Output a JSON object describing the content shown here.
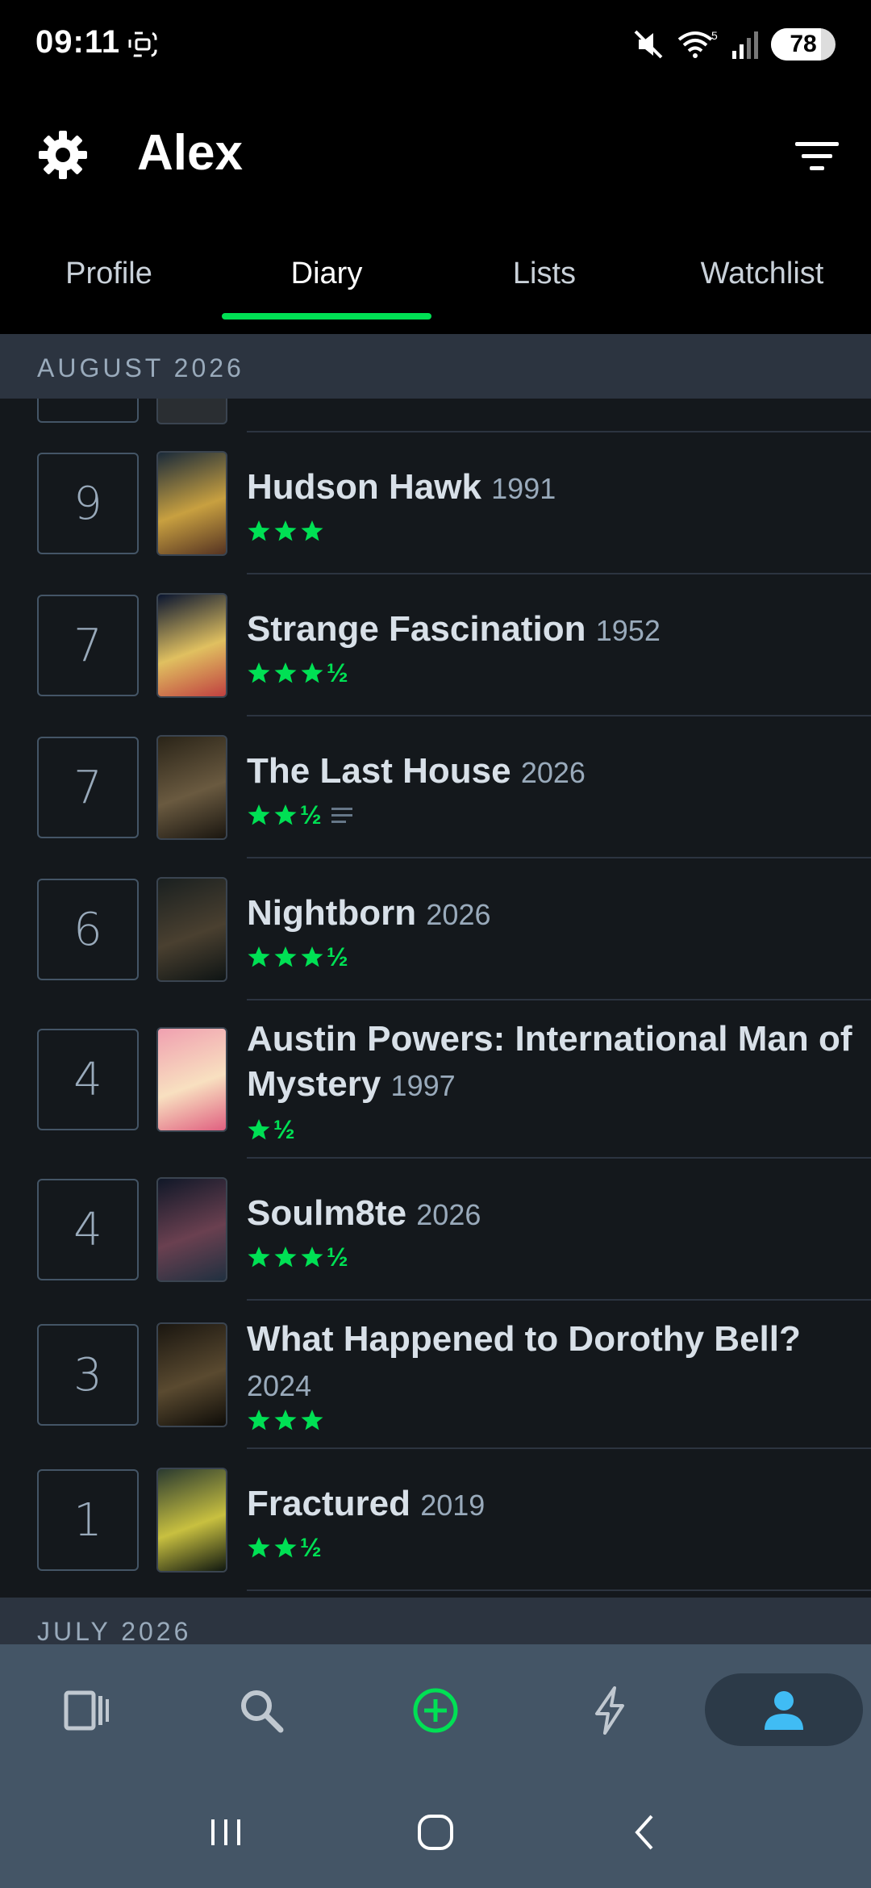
{
  "status_bar": {
    "time": "09:11",
    "battery": "78"
  },
  "header": {
    "title": "Alex"
  },
  "tabs": [
    {
      "label": "Profile",
      "active": false
    },
    {
      "label": "Diary",
      "active": true
    },
    {
      "label": "Lists",
      "active": false
    },
    {
      "label": "Watchlist",
      "active": false
    }
  ],
  "sections": [
    {
      "label": "AUGUST 2026"
    },
    {
      "label": "JULY 2026"
    }
  ],
  "entries": [
    {
      "day": "9",
      "title": "Hudson Hawk",
      "year": "1991",
      "stars": 3,
      "half": false,
      "review": false,
      "poster_colors": [
        "#1a2a3a",
        "#c8a040",
        "#553322"
      ]
    },
    {
      "day": "7",
      "title": "Strange Fascination",
      "year": "1952",
      "stars": 3,
      "half": true,
      "review": false,
      "poster_colors": [
        "#0a1530",
        "#e0c060",
        "#c04040"
      ]
    },
    {
      "day": "7",
      "title": "The Last House",
      "year": "2026",
      "stars": 2,
      "half": true,
      "review": true,
      "poster_colors": [
        "#2a2418",
        "#6a5a40",
        "#1a1610"
      ]
    },
    {
      "day": "6",
      "title": "Nightborn",
      "year": "2026",
      "stars": 3,
      "half": true,
      "review": false,
      "poster_colors": [
        "#1a2020",
        "#4a4030",
        "#0e1414"
      ]
    },
    {
      "day": "4",
      "title": "Austin Powers: International Man of Mystery",
      "year": "1997",
      "stars": 1,
      "half": true,
      "review": false,
      "poster_colors": [
        "#f0a0b0",
        "#f8e0c0",
        "#e06080"
      ]
    },
    {
      "day": "4",
      "title": "Soulm8te",
      "year": "2026",
      "stars": 3,
      "half": true,
      "review": false,
      "poster_colors": [
        "#101828",
        "#6a4050",
        "#203040"
      ]
    },
    {
      "day": "3",
      "title": "What Happened to Dorothy Bell?",
      "year": "2024",
      "stars": 3,
      "half": false,
      "review": false,
      "poster_colors": [
        "#1a1610",
        "#5a4a30",
        "#0e0c08"
      ]
    },
    {
      "day": "1",
      "title": "Fractured",
      "year": "2019",
      "stars": 2,
      "half": true,
      "review": false,
      "poster_colors": [
        "#2a3a30",
        "#c8c040",
        "#101810"
      ]
    }
  ],
  "colors": {
    "accent": "#00e054",
    "background": "#14181c",
    "nav": "#445566"
  }
}
